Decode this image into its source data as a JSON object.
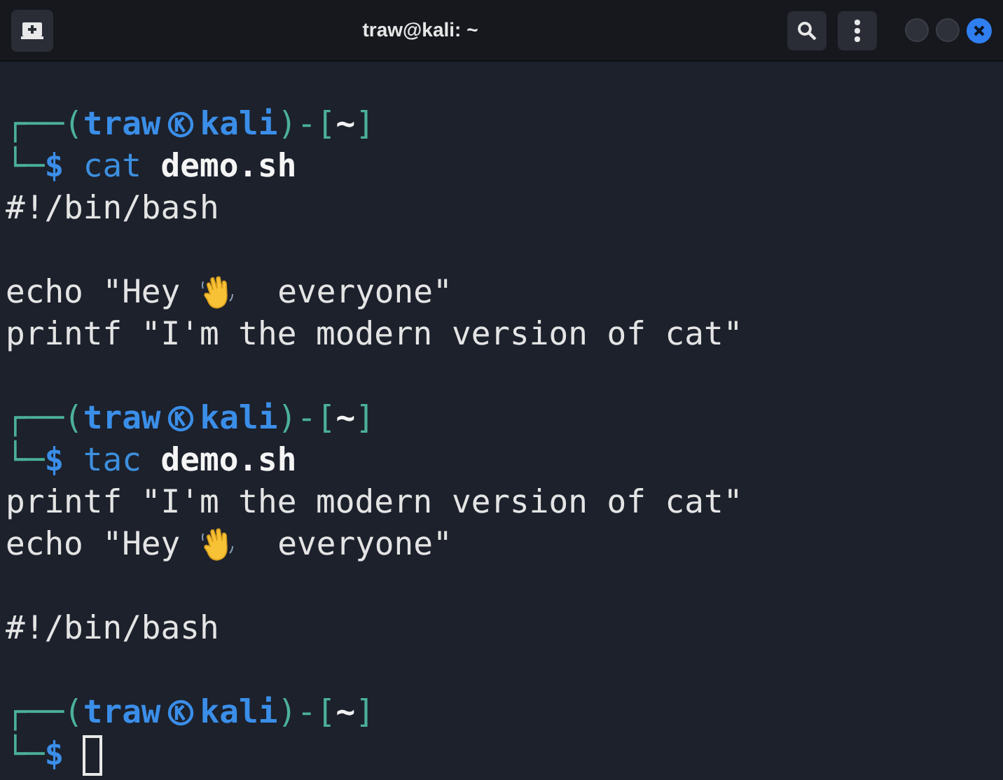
{
  "window": {
    "title": "traw@kali: ~"
  },
  "lines": [
    {
      "kind": "blank"
    },
    {
      "kind": "text",
      "segments": [
        {
          "kind": "frame",
          "text": "┌──("
        },
        {
          "kind": "user",
          "text": "traw"
        },
        {
          "kind": "icon"
        },
        {
          "kind": "user",
          "text": "kali"
        },
        {
          "kind": "frame",
          "text": ")-["
        },
        {
          "kind": "dir",
          "text": "~"
        },
        {
          "kind": "frame",
          "text": "]"
        }
      ]
    },
    {
      "kind": "text",
      "segments": [
        {
          "kind": "frame",
          "text": "└─"
        },
        {
          "kind": "dollar",
          "text": "$ "
        },
        {
          "kind": "cmd",
          "text": "cat "
        },
        {
          "kind": "arg",
          "text": "demo.sh"
        }
      ]
    },
    {
      "kind": "text",
      "segments": [
        {
          "kind": "out",
          "text": "#!/bin/bash"
        }
      ]
    },
    {
      "kind": "blank"
    },
    {
      "kind": "text",
      "segments": [
        {
          "kind": "out",
          "text": "echo \"Hey "
        },
        {
          "kind": "wave"
        },
        {
          "kind": "out",
          "text": "  everyone\""
        }
      ]
    },
    {
      "kind": "text",
      "segments": [
        {
          "kind": "out",
          "text": "printf \"I'm the modern version of cat\""
        }
      ]
    },
    {
      "kind": "blank"
    },
    {
      "kind": "text",
      "segments": [
        {
          "kind": "frame",
          "text": "┌──("
        },
        {
          "kind": "user",
          "text": "traw"
        },
        {
          "kind": "icon"
        },
        {
          "kind": "user",
          "text": "kali"
        },
        {
          "kind": "frame",
          "text": ")-["
        },
        {
          "kind": "dir",
          "text": "~"
        },
        {
          "kind": "frame",
          "text": "]"
        }
      ]
    },
    {
      "kind": "text",
      "segments": [
        {
          "kind": "frame",
          "text": "└─"
        },
        {
          "kind": "dollar",
          "text": "$ "
        },
        {
          "kind": "cmd",
          "text": "tac "
        },
        {
          "kind": "arg",
          "text": "demo.sh"
        }
      ]
    },
    {
      "kind": "text",
      "segments": [
        {
          "kind": "out",
          "text": "printf \"I'm the modern version of cat\""
        }
      ]
    },
    {
      "kind": "text",
      "segments": [
        {
          "kind": "out",
          "text": "echo \"Hey "
        },
        {
          "kind": "wave"
        },
        {
          "kind": "out",
          "text": "  everyone\""
        }
      ]
    },
    {
      "kind": "blank"
    },
    {
      "kind": "text",
      "segments": [
        {
          "kind": "out",
          "text": "#!/bin/bash"
        }
      ]
    },
    {
      "kind": "blank"
    },
    {
      "kind": "text",
      "segments": [
        {
          "kind": "frame",
          "text": "┌──("
        },
        {
          "kind": "user",
          "text": "traw"
        },
        {
          "kind": "icon"
        },
        {
          "kind": "user",
          "text": "kali"
        },
        {
          "kind": "frame",
          "text": ")-["
        },
        {
          "kind": "dir",
          "text": "~"
        },
        {
          "kind": "frame",
          "text": "]"
        }
      ]
    },
    {
      "kind": "text",
      "cursor": true,
      "segments": [
        {
          "kind": "frame",
          "text": "└─"
        },
        {
          "kind": "dollar",
          "text": "$ "
        }
      ]
    }
  ]
}
